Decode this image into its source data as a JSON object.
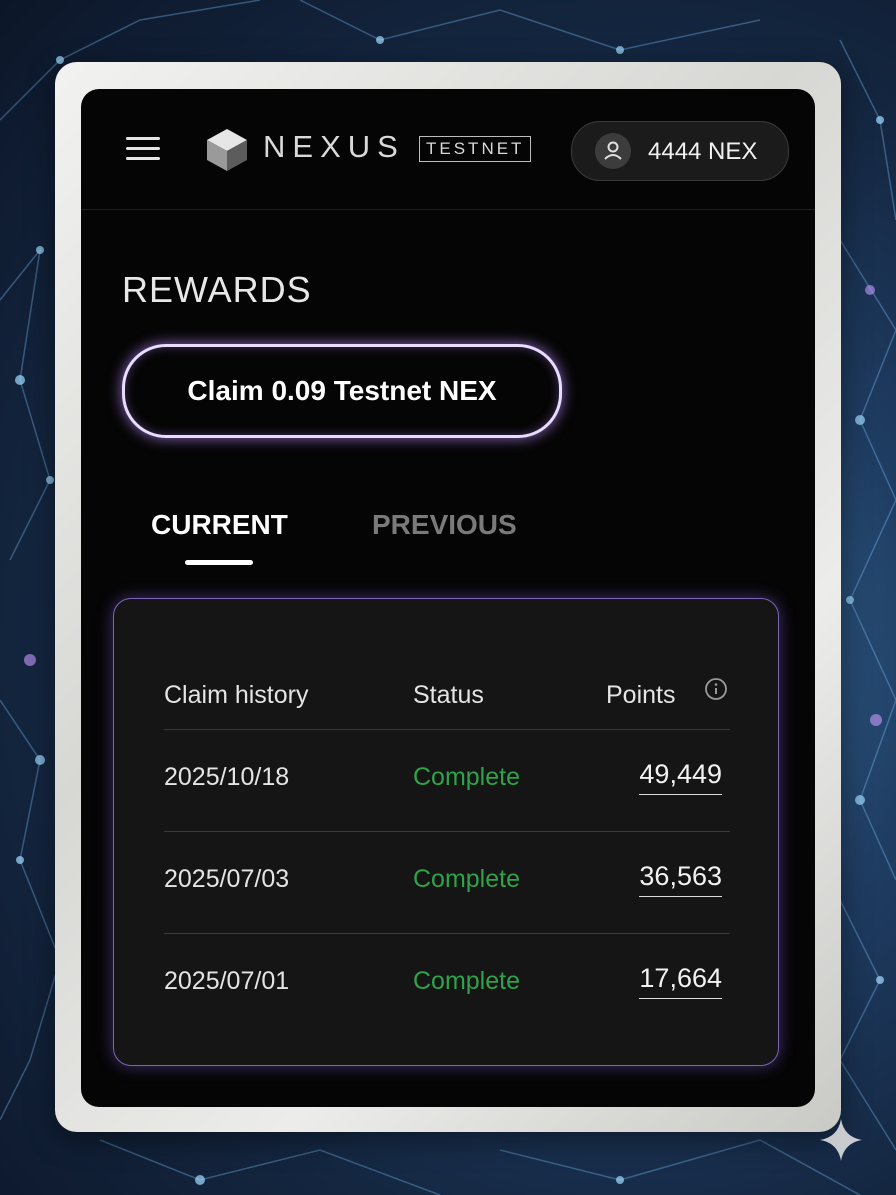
{
  "header": {
    "logo_text": "NEXUS",
    "badge": "TESTNET",
    "balance": "4444 NEX"
  },
  "rewards": {
    "title": "REWARDS",
    "claim_button": "Claim 0.09 Testnet NEX"
  },
  "tabs": [
    {
      "label": "CURRENT",
      "active": true
    },
    {
      "label": "PREVIOUS",
      "active": false
    }
  ],
  "history": {
    "columns": {
      "claim_history": "Claim history",
      "status": "Status",
      "points": "Points"
    },
    "rows": [
      {
        "date": "2025/10/18",
        "status": "Complete",
        "points": "49,449"
      },
      {
        "date": "2025/07/03",
        "status": "Complete",
        "points": "36,563"
      },
      {
        "date": "2025/07/01",
        "status": "Complete",
        "points": "17,664"
      }
    ]
  },
  "colors": {
    "accent_glow": "#b98cff",
    "status_complete": "#2fa24a",
    "screen_bg": "#050505"
  },
  "icons": [
    "menu-icon",
    "cube-logo-icon",
    "user-icon",
    "info-icon",
    "sparkle-icon"
  ]
}
